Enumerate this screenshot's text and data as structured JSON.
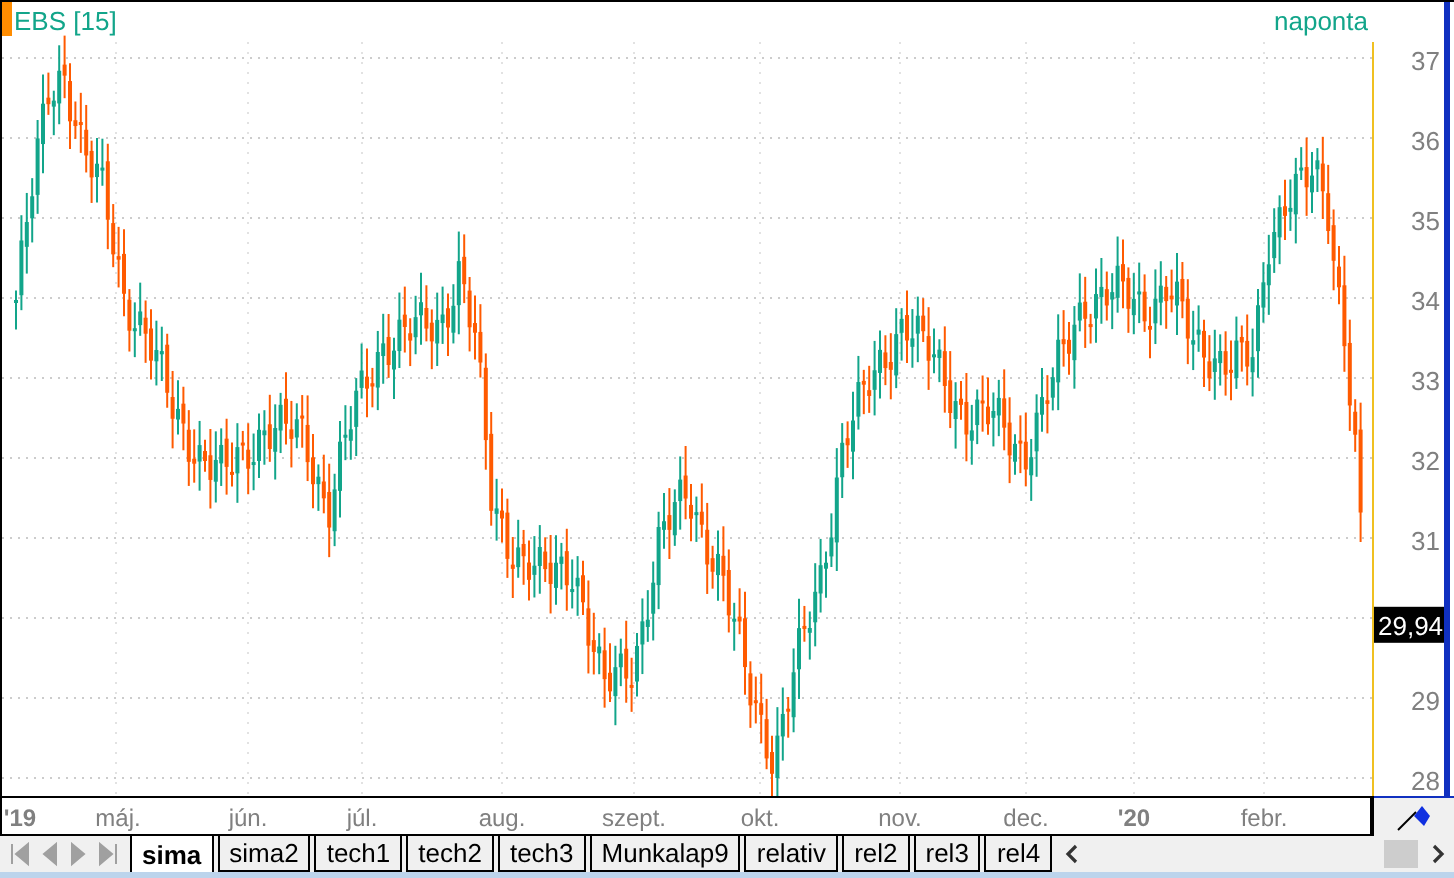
{
  "chart": {
    "title": "EBS [15]",
    "period": "naponta"
  },
  "price_axis": {
    "ticks": [
      "37",
      "36",
      "35",
      "34",
      "33",
      "32",
      "31",
      "29",
      "28"
    ],
    "current_price": "29,94"
  },
  "time_axis": [
    {
      "label": "'19",
      "kind": "year"
    },
    {
      "label": "máj.",
      "kind": "month"
    },
    {
      "label": "jún.",
      "kind": "month"
    },
    {
      "label": "júl.",
      "kind": "month"
    },
    {
      "label": "aug.",
      "kind": "month"
    },
    {
      "label": "szept.",
      "kind": "month"
    },
    {
      "label": "okt.",
      "kind": "month"
    },
    {
      "label": "nov.",
      "kind": "month"
    },
    {
      "label": "dec.",
      "kind": "month"
    },
    {
      "label": "'20",
      "kind": "year"
    },
    {
      "label": "febr.",
      "kind": "month"
    }
  ],
  "sheet_tabs": [
    {
      "label": "sima",
      "selected": true
    },
    {
      "label": "sima2",
      "selected": false
    },
    {
      "label": "tech1",
      "selected": false
    },
    {
      "label": "tech2",
      "selected": false
    },
    {
      "label": "tech3",
      "selected": false
    },
    {
      "label": "Munkalap9",
      "selected": false
    },
    {
      "label": "relativ",
      "selected": false
    },
    {
      "label": "rel2",
      "selected": false
    },
    {
      "label": "rel3",
      "selected": false
    },
    {
      "label": "rel4",
      "selected": false
    }
  ]
}
